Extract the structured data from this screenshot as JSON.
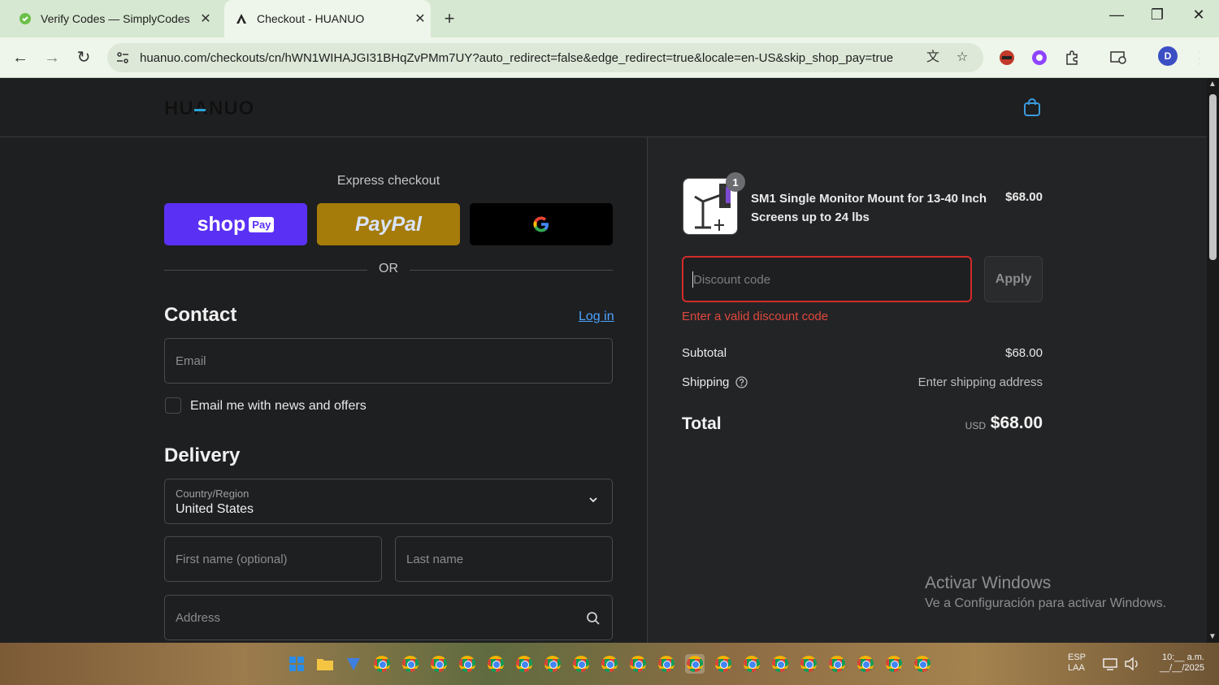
{
  "browser": {
    "tabs": [
      {
        "title": "Verify Codes — SimplyCodes",
        "close": "✕"
      },
      {
        "title": "Checkout - HUANUO",
        "close": "✕"
      }
    ],
    "new_tab": "+",
    "url": "huanuo.com/checkouts/cn/hWN1WIHAJGI31BHqZvPMm7UY?auto_redirect=false&edge_redirect=true&locale=en-US&skip_shop_pay=true",
    "profile_initial": "D"
  },
  "header": {
    "logo": "HUANUO"
  },
  "checkout": {
    "express_title": "Express checkout",
    "shop_pay": {
      "word": "shop",
      "badge": "Pay"
    },
    "paypal": "PayPal",
    "google": "G",
    "or": "OR",
    "contact": {
      "heading": "Contact",
      "login": "Log in",
      "email_placeholder": "Email",
      "news_label": "Email me with news and offers"
    },
    "delivery": {
      "heading": "Delivery",
      "country_label": "Country/Region",
      "country_value": "United States",
      "first_name_placeholder": "First name (optional)",
      "last_name_placeholder": "Last name",
      "address_placeholder": "Address"
    }
  },
  "summary": {
    "product": {
      "title": "SM1 Single Monitor Mount for 13-40 Inch Screens up to 24 lbs",
      "price": "$68.00",
      "quantity": "1"
    },
    "discount": {
      "placeholder": "Discount code",
      "apply": "Apply",
      "error": "Enter a valid discount code"
    },
    "subtotal_label": "Subtotal",
    "subtotal_value": "$68.00",
    "shipping_label": "Shipping",
    "shipping_value": "Enter shipping address",
    "total_label": "Total",
    "total_currency": "USD",
    "total_value": "$68.00"
  },
  "watermark": {
    "line1": "Activar Windows",
    "line2": "Ve a Configuración para activar Windows."
  },
  "taskbar": {
    "lang": "ESP",
    "lang_sub": "LAA",
    "time": "10:__ a.m.",
    "date": "__/__/2025"
  },
  "colors": {
    "error": "#d12b2b",
    "link": "#4da3ff",
    "shop_pay": "#5a31f4",
    "paypal": "#a57b0a"
  }
}
